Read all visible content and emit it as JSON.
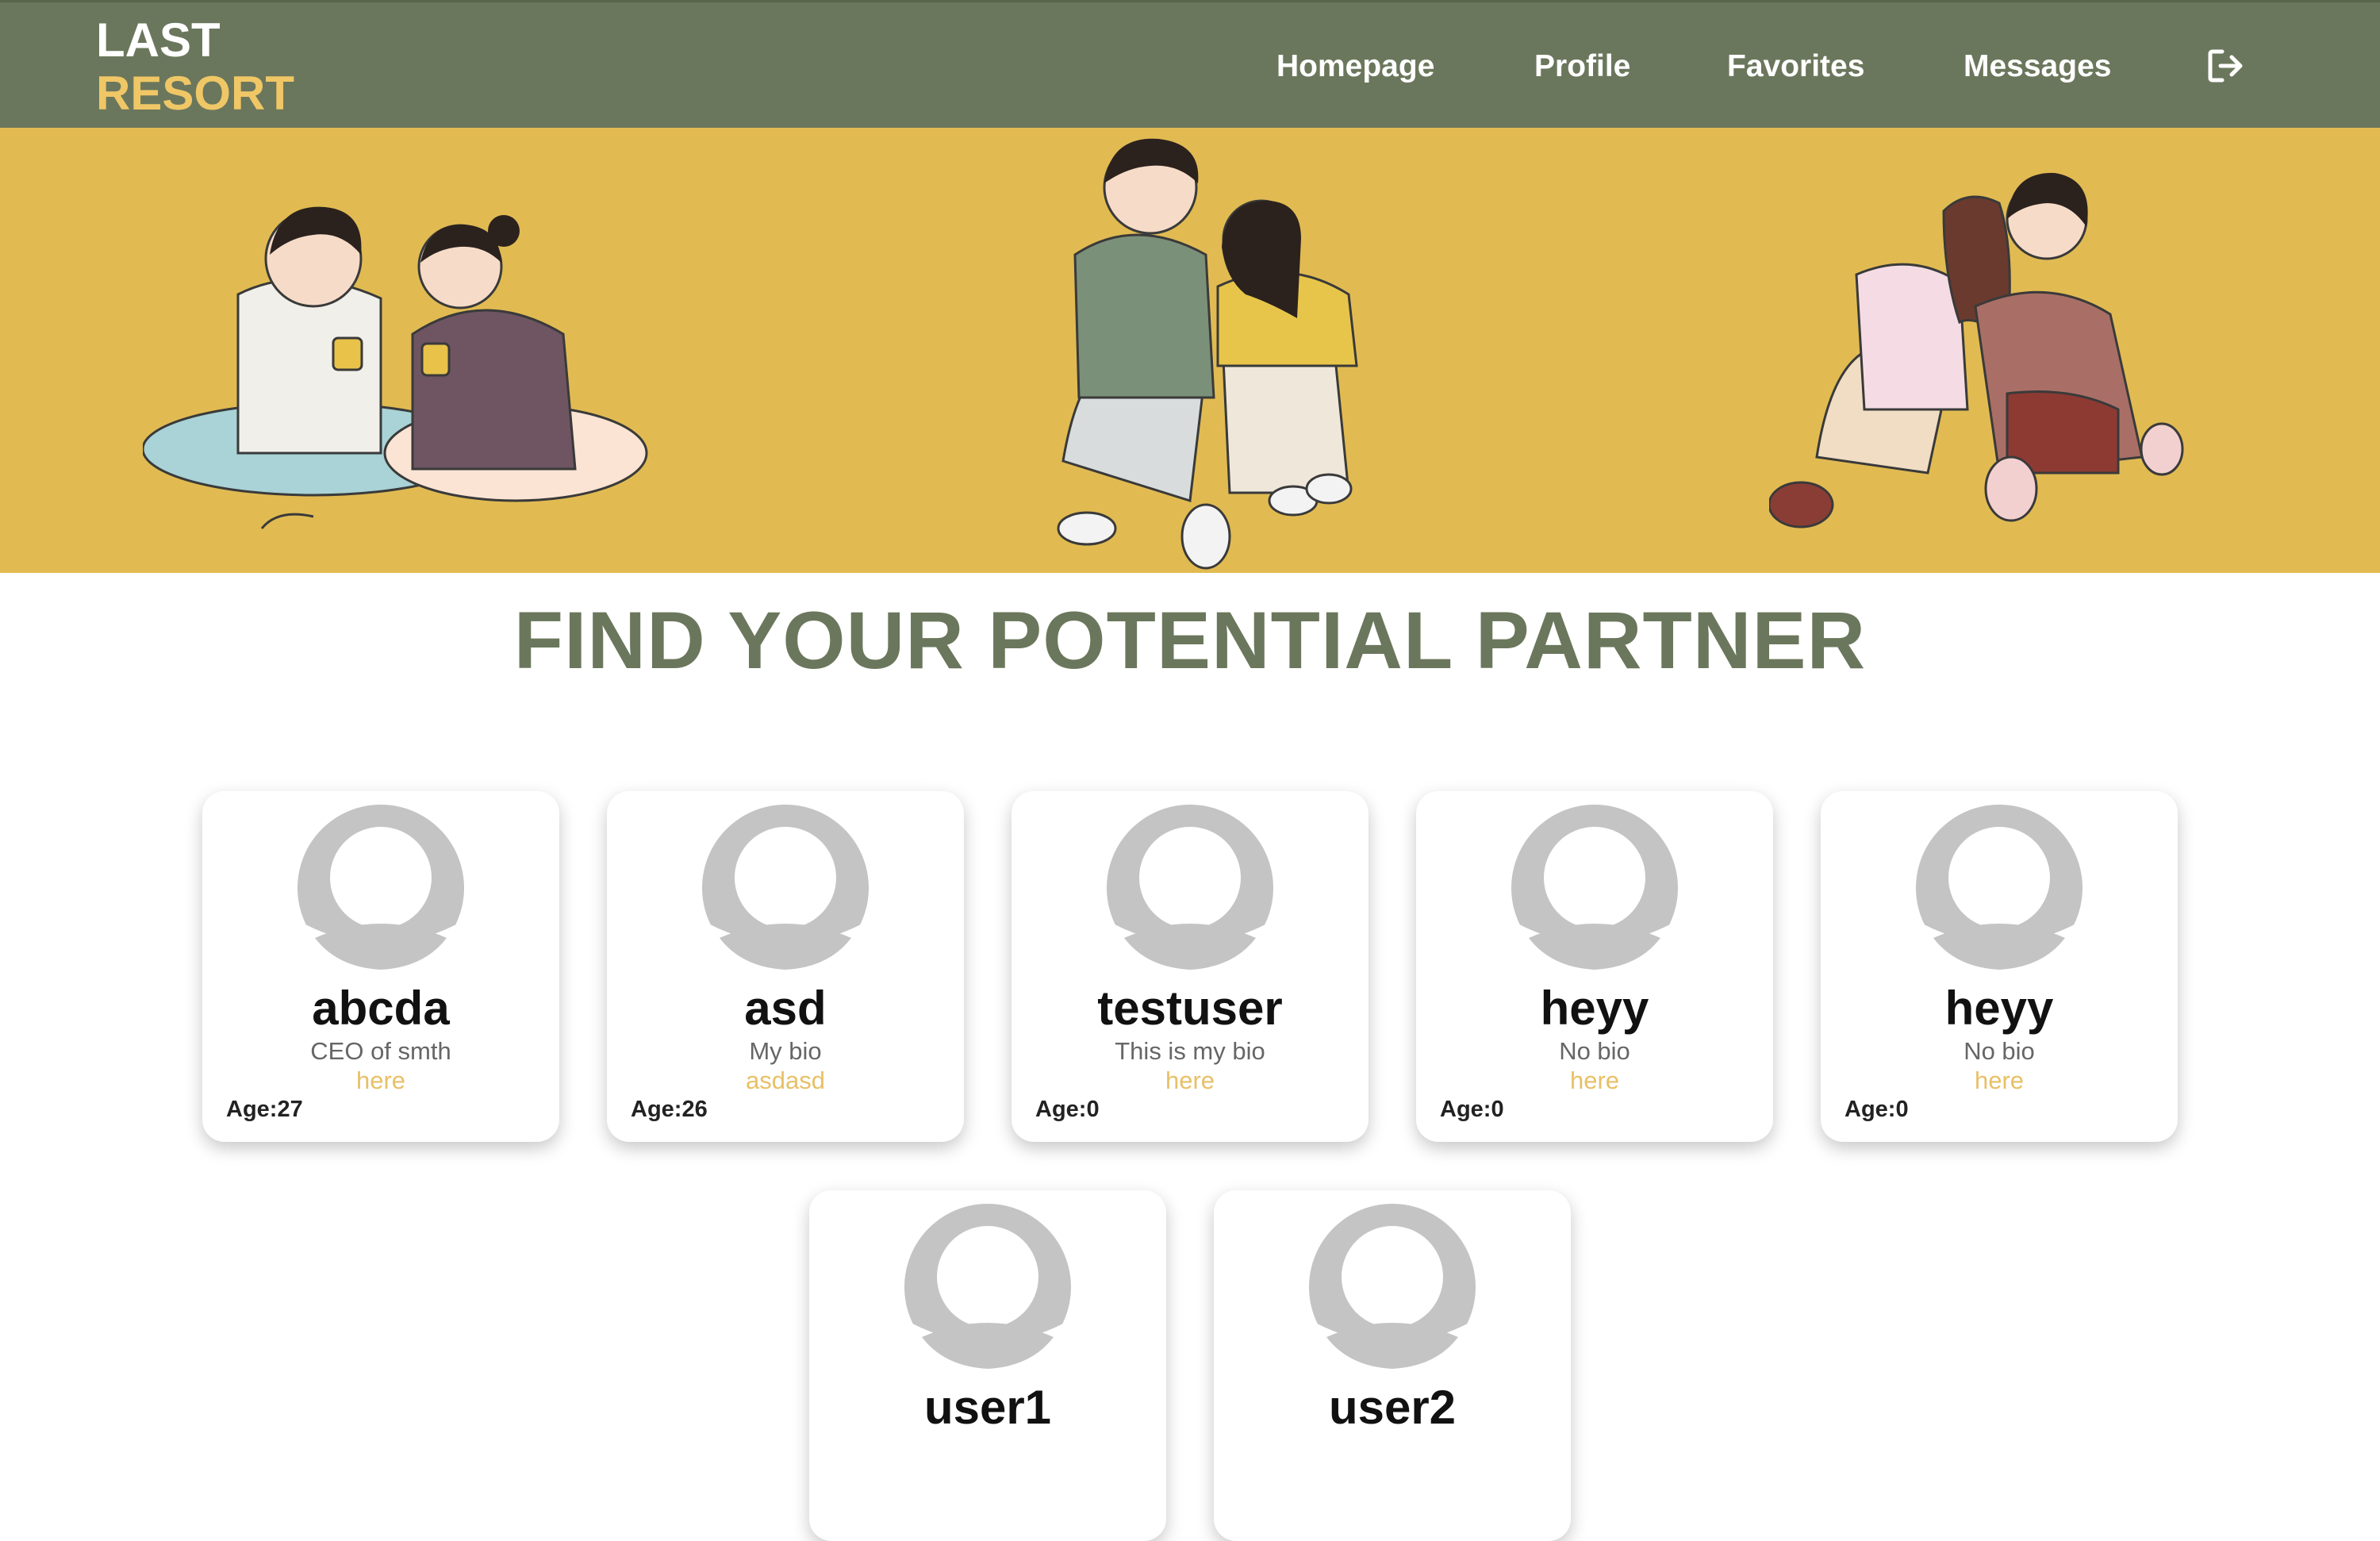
{
  "brand": {
    "line1": "LAST",
    "line2": "RESORT",
    "color_primary": "#ffffff",
    "color_accent": "#f0c766"
  },
  "nav": {
    "items": [
      {
        "label": "Homepage"
      },
      {
        "label": "Profile"
      },
      {
        "label": "Favorites"
      },
      {
        "label": "Messages"
      }
    ],
    "logout_icon": "sign-out-icon"
  },
  "hero": {
    "background": "#e1bb52",
    "illustrations": [
      "couple-drinking-coffee",
      "couple-leaning-together",
      "couple-embracing"
    ]
  },
  "headline": "FIND YOUR POTENTIAL PARTNER",
  "age_label": "Age:",
  "profiles": [
    {
      "name": "abcda",
      "bio": "CEO of smth",
      "extra": "here",
      "age": "27"
    },
    {
      "name": "asd",
      "bio": "My bio",
      "extra": "asdasd",
      "age": "26"
    },
    {
      "name": "testuser",
      "bio": "This is my bio",
      "extra": "here",
      "age": "0"
    },
    {
      "name": "heyy",
      "bio": "No bio",
      "extra": "here",
      "age": "0"
    },
    {
      "name": "heyy",
      "bio": "No bio",
      "extra": "here",
      "age": "0"
    },
    {
      "name": "user1",
      "bio": "",
      "extra": "",
      "age": ""
    },
    {
      "name": "user2",
      "bio": "",
      "extra": "",
      "age": ""
    }
  ],
  "colors": {
    "navbar": "#6b775c",
    "title": "#6b775c",
    "avatar_gray": "#c4c4c4",
    "link_yellow": "#e8c066"
  }
}
